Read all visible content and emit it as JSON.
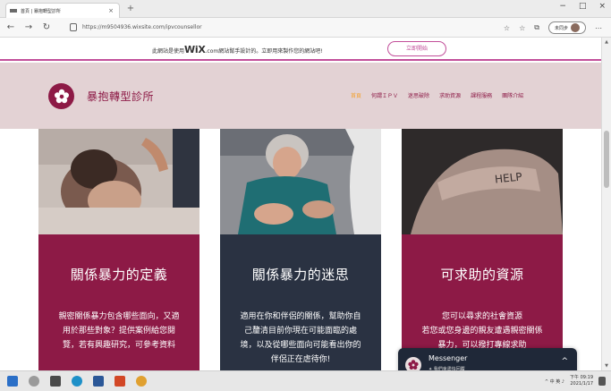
{
  "browser": {
    "tab_title": "首頁 | 暴抱轉型診所",
    "tab_close": "×",
    "new_tab": "+",
    "window_controls": [
      "−",
      "□",
      "×"
    ],
    "nav_icons": [
      "←",
      "→",
      "↻"
    ],
    "url": "https://m9504936.wixsite.com/ipvcounsellor",
    "right_icons": [
      "☆",
      "☆",
      "⧉",
      "⋯"
    ],
    "user_label": "未同步"
  },
  "wix_banner": {
    "text_before": "此網站是使用",
    "logo": "WiX",
    "text_after": ".com網站幫手設計的。立即用來製作您的網站吧!",
    "cta": "立即開始"
  },
  "site": {
    "name": "暴抱轉型診所",
    "nav": [
      {
        "label": "首頁",
        "active": true
      },
      {
        "label": "何謂ＩＰＶ",
        "active": false
      },
      {
        "label": "迷思破除",
        "active": false
      },
      {
        "label": "求助資源",
        "active": false
      },
      {
        "label": "課程服務",
        "active": false
      },
      {
        "label": "團隊介紹",
        "active": false
      }
    ]
  },
  "cards": [
    {
      "title": "關係暴力的定義",
      "body": [
        "親密關係暴力包含哪些面向，又適",
        "用於那些對象？提供案例給您閱",
        "覽，若有興趣研究，可參考資料"
      ]
    },
    {
      "title": "關係暴力的迷思",
      "body": [
        "適用在你和伴侶的關係，幫助你自",
        "己釐清目前你現在可能面臨的處",
        "境，以及從哪些面向可能看出你的",
        "伴侶正在虐待你!"
      ]
    },
    {
      "title": "可求助的資源",
      "body": [
        "您可以尋求的社會資源",
        "若您或您身邊的親友遭遇親密關係",
        "暴力，可以撥打專線求助"
      ]
    }
  ],
  "photo3_text": "HELP",
  "messenger": {
    "name": "Messenger",
    "subtitle": "✦ 我們會盡快回覆",
    "toggle": "^"
  },
  "taskbar": {
    "tray": "^ 中 英 ♪",
    "time": "下午 09:19",
    "date": "2021/1/17"
  },
  "colors": {
    "brand": "#8d1a46",
    "nav_active": "#f2a232",
    "header_bg": "#e3d2d4",
    "navy": "#2a3242",
    "wix_accent": "#c24f9a"
  }
}
